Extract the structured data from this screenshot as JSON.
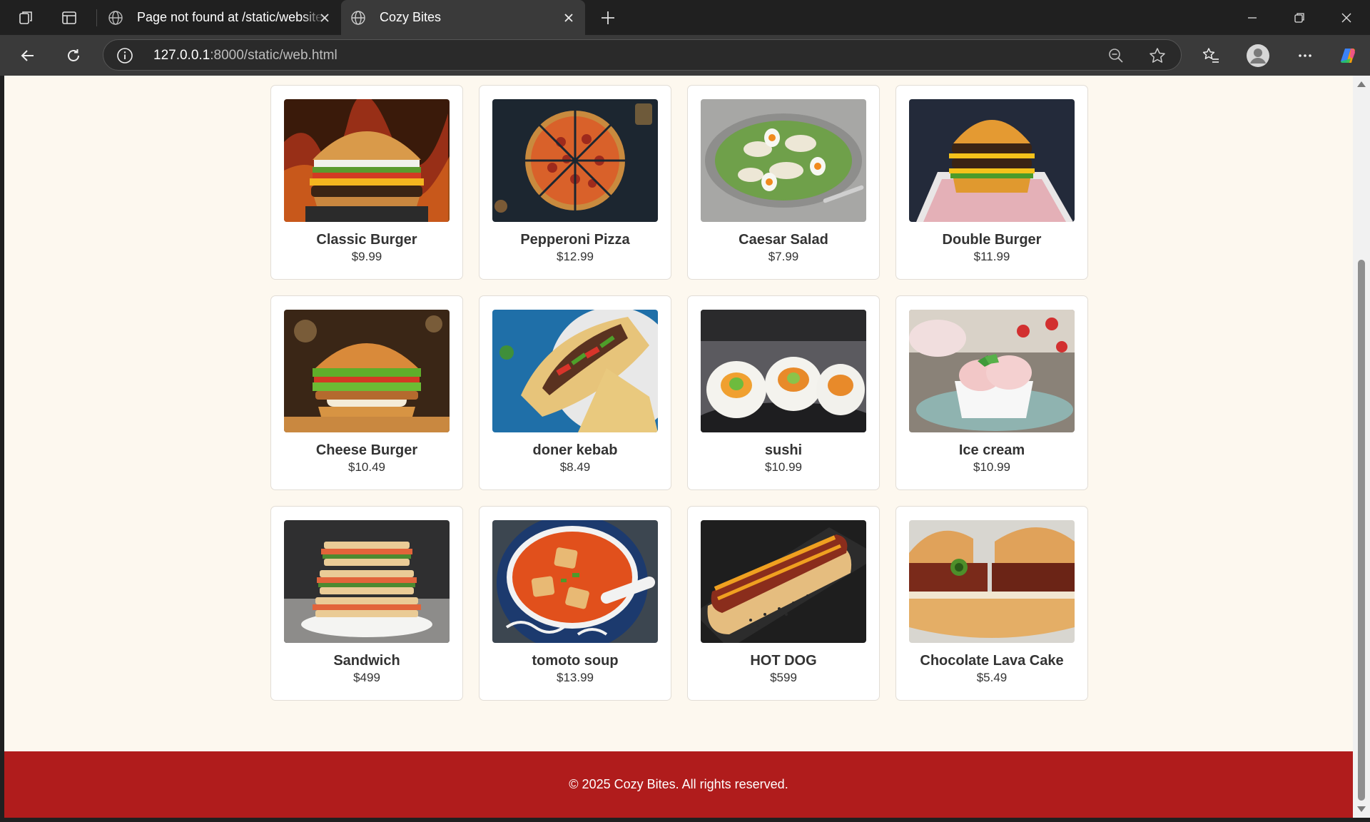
{
  "browser": {
    "tabs": [
      {
        "title": "Page not found at /static/website",
        "active": false
      },
      {
        "title": "Cozy Bites",
        "active": true
      }
    ],
    "url_host": "127.0.0.1",
    "url_rest": ":8000/static/web.html"
  },
  "menu": {
    "items": [
      {
        "name": "Classic Burger",
        "price": "$9.99",
        "image": "burger-photo"
      },
      {
        "name": "Pepperoni Pizza",
        "price": "$12.99",
        "image": "pizza-photo"
      },
      {
        "name": "Caesar Salad",
        "price": "$7.99",
        "image": "salad-photo"
      },
      {
        "name": "Double Burger",
        "price": "$11.99",
        "image": "burger-photo"
      },
      {
        "name": "Cheese Burger",
        "price": "$10.49",
        "image": "burger-photo"
      },
      {
        "name": "doner kebab",
        "price": "$8.49",
        "image": "kebab-photo"
      },
      {
        "name": "sushi",
        "price": "$10.99",
        "image": "sushi-photo"
      },
      {
        "name": "Ice cream",
        "price": "$10.99",
        "image": "ice-cream-photo"
      },
      {
        "name": "Sandwich",
        "price": "$499",
        "image": "sandwich-photo"
      },
      {
        "name": "tomoto soup",
        "price": "$13.99",
        "image": "soup-photo"
      },
      {
        "name": "HOT DOG",
        "price": "$599",
        "image": "hot-dog-photo"
      },
      {
        "name": "Chocolate Lava Cake",
        "price": "$5.49",
        "image": "burger-photo"
      }
    ]
  },
  "footer": {
    "text": "© 2025 Cozy Bites. All rights reserved."
  },
  "colors": {
    "footer_bg": "#b01c1c",
    "page_bg": "#fdf8ef",
    "card_bg": "#ffffff"
  }
}
